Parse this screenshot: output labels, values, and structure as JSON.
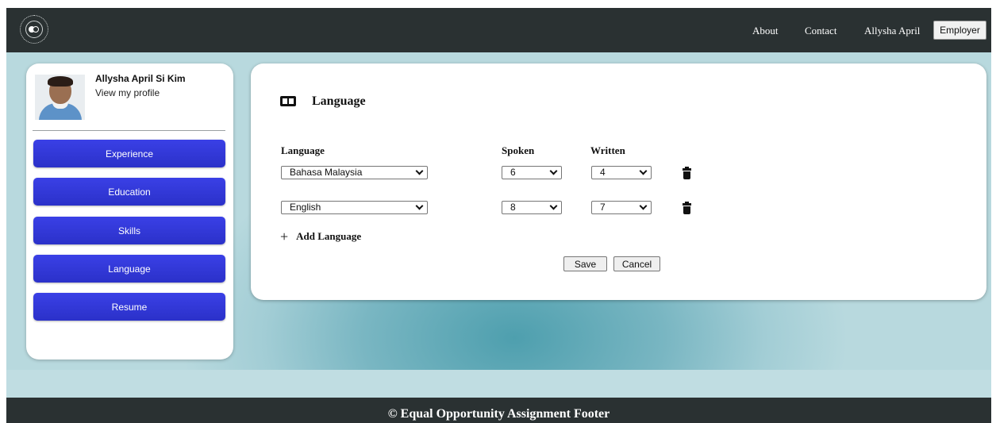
{
  "navbar": {
    "links": [
      "About",
      "Contact",
      "Allysha April"
    ],
    "employer_button": "Employer"
  },
  "profile": {
    "name": "Allysha April Si Kim",
    "view_profile": "View my profile"
  },
  "sidebar": {
    "items": [
      "Experience",
      "Education",
      "Skills",
      "Language",
      "Resume"
    ]
  },
  "language_section": {
    "title": "Language",
    "columns": {
      "language": "Language",
      "spoken": "Spoken",
      "written": "Written"
    },
    "rows": [
      {
        "language": "Bahasa Malaysia",
        "spoken": "6",
        "written": "4"
      },
      {
        "language": "English",
        "spoken": "8",
        "written": "7"
      }
    ],
    "add_label": "Add Language",
    "save": "Save",
    "cancel": "Cancel"
  },
  "footer": {
    "text": "© Equal Opportunity Assignment Footer"
  },
  "colors": {
    "navbar": "#2a3132",
    "sidebar_button": "#3038d9",
    "background_teal": "#79b6c2"
  }
}
